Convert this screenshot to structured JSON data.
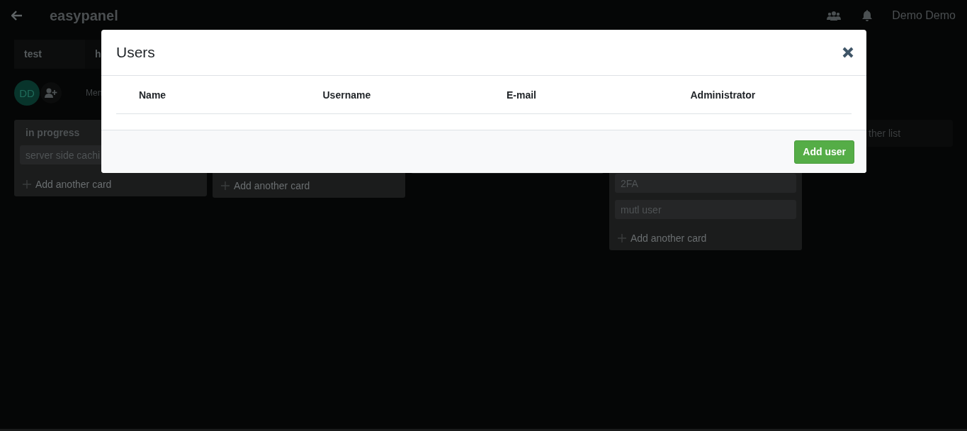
{
  "topbar": {
    "title": "easypanel",
    "user": "Demo Demo"
  },
  "board_tabs": [
    "test",
    "h"
  ],
  "members": {
    "avatar": "DD",
    "menu_label": "Men"
  },
  "lists": [
    {
      "kind": "list",
      "title": "in progress",
      "cards": [
        "server side cachi"
      ],
      "add_card": "Add another card"
    },
    {
      "kind": "list",
      "add_card": "Add another card"
    },
    {
      "kind": "empty"
    },
    {
      "kind": "list",
      "cards": [
        "2FA",
        "mutl user"
      ],
      "add_card": "Add another card"
    }
  ],
  "add_list": "ther list",
  "modal": {
    "title": "Users",
    "columns": [
      "Name",
      "Username",
      "E-mail",
      "Administrator"
    ],
    "button": "Add user"
  }
}
